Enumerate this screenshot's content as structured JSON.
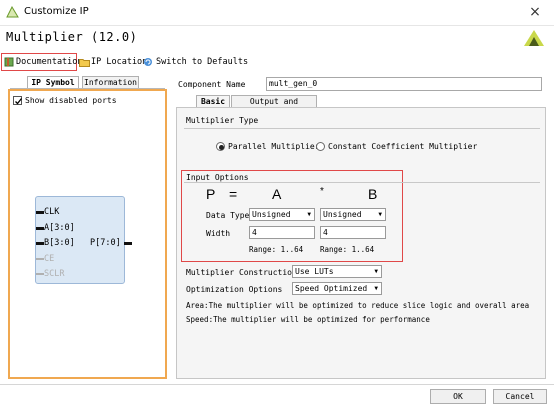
{
  "window": {
    "title": "Customize IP",
    "close_glyph": "×"
  },
  "header": {
    "title": "Multiplier (12.0)"
  },
  "toolbar": {
    "documentation": "Documentation",
    "ip_location": "IP Location",
    "switch_defaults": "Switch to Defaults"
  },
  "left": {
    "tabs": [
      "IP Symbol",
      "Information"
    ],
    "show_disabled_ports": "Show disabled ports",
    "ports_in": [
      "CLK",
      "A[3:0]",
      "B[3:0]",
      "CE",
      "SCLR"
    ],
    "port_out": "P[7:0]"
  },
  "component": {
    "label": "Component Name",
    "value": "mult_gen_0"
  },
  "tabs": [
    "Basic",
    "Output and Control"
  ],
  "multiplier_type": {
    "title": "Multiplier Type",
    "options": [
      "Parallel Multiplier",
      "Constant Coefficient Multiplier"
    ],
    "selected": "Parallel Multiplier"
  },
  "input_options": {
    "title": "Input Options",
    "symbols": [
      "P",
      "=",
      "A",
      "*",
      "B"
    ],
    "data_type_label": "Data Type",
    "width_label": "Width",
    "a": {
      "data_type": "Unsigned",
      "width": "4",
      "range": "Range: 1..64"
    },
    "b": {
      "data_type": "Unsigned",
      "width": "4",
      "range": "Range: 1..64"
    }
  },
  "construction": {
    "label": "Multiplier Construction",
    "value": "Use LUTs"
  },
  "optimization": {
    "label": "Optimization Options",
    "value": "Speed Optimized"
  },
  "notes": [
    "Area:The multiplier will be optimized to reduce slice logic and overall area",
    "Speed:The multiplier will be optimized for performance"
  ],
  "buttons": {
    "ok": "OK",
    "cancel": "Cancel"
  },
  "colors": {
    "highlight_red": "#e04848",
    "left_panel_orange": "#f0a850",
    "symbol_fill": "#dbe8f5"
  }
}
